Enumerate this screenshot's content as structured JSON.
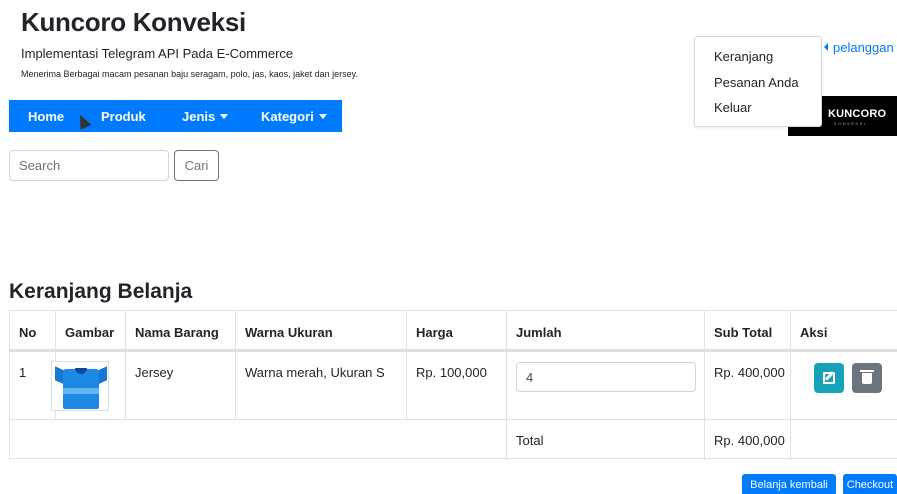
{
  "brand": {
    "title": "Kuncoro Konveksi",
    "subtitle": "Implementasi Telegram API Pada E-Commerce",
    "description": "Menerima Berbagai macam pesanan baju seragam, polo, jas, kaos, jaket dan jersey."
  },
  "nav": {
    "home": "Home",
    "produk": "Produk",
    "jenis": "Jenis",
    "kategori": "Kategori"
  },
  "search": {
    "placeholder": "Search",
    "button": "Cari"
  },
  "user_menu": {
    "label": "pelanggan",
    "items": [
      "Keranjang",
      "Pesanan Anda",
      "Keluar"
    ]
  },
  "logo": {
    "text": "KUNCORO",
    "subtext": "KONVEKSI"
  },
  "cart": {
    "title": "Keranjang Belanja",
    "headers": [
      "No",
      "Gambar",
      "Nama Barang",
      "Warna Ukuran",
      "Harga",
      "Jumlah",
      "Sub Total",
      "Aksi"
    ],
    "rows": [
      {
        "no": "1",
        "image_icon": "jersey-image",
        "name": "Jersey",
        "color_size": "Warna merah, Ukuran S",
        "price": "Rp. 100,000",
        "quantity": "4",
        "subtotal": "Rp. 400,000"
      }
    ],
    "total_label": "Total",
    "total_value": "Rp. 400,000"
  },
  "actions": {
    "continue_shopping": "Belanja kembali",
    "checkout": "Checkout"
  },
  "colors": {
    "primary": "#007bff",
    "info": "#17a2b8",
    "secondary": "#6c757d"
  }
}
